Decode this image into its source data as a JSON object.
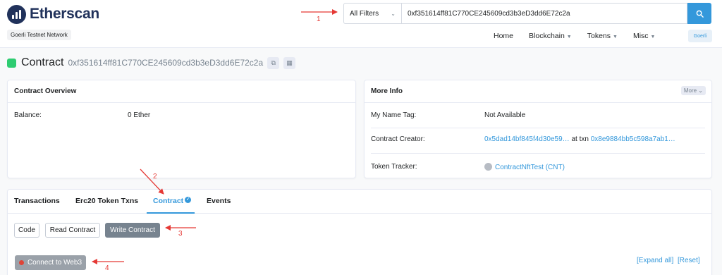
{
  "brand": {
    "name": "Etherscan",
    "network": "Goerli Testnet Network"
  },
  "search": {
    "filter": "All Filters",
    "value": "0xf351614ff81C770CE245609cd3b3eD3dd6E72c2a"
  },
  "nav": {
    "home": "Home",
    "blockchain": "Blockchain",
    "tokens": "Tokens",
    "misc": "Misc",
    "network_button": "Goerli"
  },
  "page": {
    "title": "Contract",
    "address": "0xf351614ff81C770CE245609cd3b3eD3dd6E72c2a"
  },
  "overview": {
    "heading": "Contract Overview",
    "balance_label": "Balance:",
    "balance_value": "0 Ether"
  },
  "more_info": {
    "heading": "More Info",
    "more_button": "More",
    "name_tag_label": "My Name Tag:",
    "name_tag_value": "Not Available",
    "creator_label": "Contract Creator:",
    "creator_address": "0x5dad14bf845f4d30e59…",
    "creator_at_txn": "at txn",
    "creator_txn": "0x8e9884bb5c598a7ab1…",
    "tracker_label": "Token Tracker:",
    "tracker_value": "ContractNftTest (CNT)"
  },
  "tabs": {
    "transactions": "Transactions",
    "erc20": "Erc20 Token Txns",
    "contract": "Contract",
    "events": "Events"
  },
  "contract_tools": {
    "code": "Code",
    "read": "Read Contract",
    "write": "Write Contract",
    "connect": "Connect to Web3",
    "expand_all": "[Expand all]",
    "reset": "[Reset]"
  },
  "annotations": {
    "n1": "1",
    "n2": "2",
    "n3": "3",
    "n4": "4"
  },
  "colors": {
    "accent": "#3498db",
    "brand": "#21325b",
    "annotation": "#e53935",
    "active_button": "#77838f"
  }
}
